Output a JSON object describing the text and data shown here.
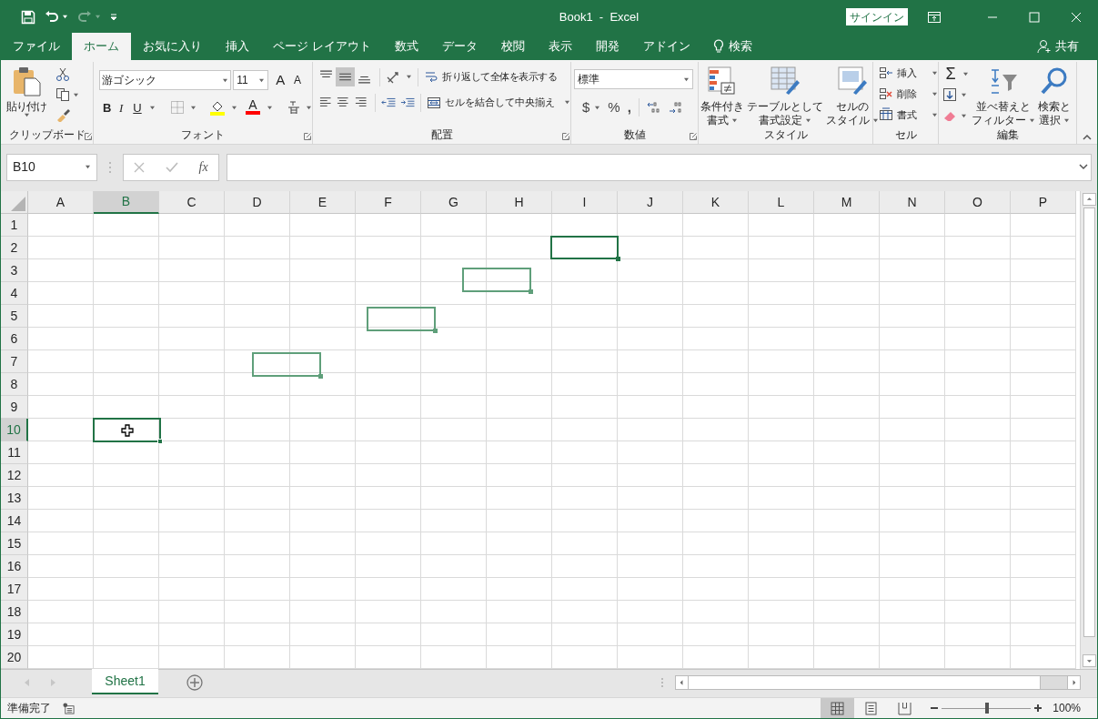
{
  "title_bar": {
    "title": "Book1  -  Excel",
    "sign_in": "サインイン"
  },
  "tabs": [
    {
      "label": "ファイル",
      "selected": false
    },
    {
      "label": "ホーム",
      "selected": true
    },
    {
      "label": "お気に入り",
      "selected": false
    },
    {
      "label": "挿入",
      "selected": false
    },
    {
      "label": "ページ レイアウト",
      "selected": false
    },
    {
      "label": "数式",
      "selected": false
    },
    {
      "label": "データ",
      "selected": false
    },
    {
      "label": "校閲",
      "selected": false
    },
    {
      "label": "表示",
      "selected": false
    },
    {
      "label": "開発",
      "selected": false
    },
    {
      "label": "アドイン",
      "selected": false
    }
  ],
  "tell_me": "検索",
  "share": "共有",
  "ribbon": {
    "clipboard": {
      "label": "クリップボード",
      "paste": "貼り付け"
    },
    "font": {
      "label": "フォント",
      "font_name": "游ゴシック",
      "font_size": "11",
      "grow": "A",
      "shrink": "A",
      "bold": "B",
      "italic": "I",
      "underline": "U",
      "font_color": "A"
    },
    "alignment": {
      "label": "配置",
      "vertical": [
        {
          "kind": "top",
          "selected": false
        },
        {
          "kind": "middle",
          "selected": true
        },
        {
          "kind": "bottom",
          "selected": false
        }
      ],
      "wrap_text": "折り返して全体を表示する",
      "merge": "セルを結合して中央揃え"
    },
    "number": {
      "label": "数値",
      "format": "標準",
      "currency": "$",
      "percent": "%",
      "comma": ","
    },
    "styles": {
      "label": "スタイル",
      "buttons": [
        {
          "kind": "conditional",
          "lines": [
            "条件付き",
            "書式"
          ]
        },
        {
          "kind": "table",
          "lines": [
            "テーブルとして",
            "書式設定"
          ]
        },
        {
          "kind": "cell_styles",
          "lines": [
            "セルの",
            "スタイル"
          ]
        }
      ]
    },
    "cells": {
      "label": "セル",
      "buttons": [
        {
          "kind": "insert",
          "label": "挿入"
        },
        {
          "kind": "delete",
          "label": "削除"
        },
        {
          "kind": "format",
          "label": "書式"
        }
      ]
    },
    "editing": {
      "label": "編集",
      "autosum": "Σ",
      "buttons": [
        {
          "kind": "sort",
          "lines": [
            "並べ替えと",
            "フィルター"
          ]
        },
        {
          "kind": "find",
          "lines": [
            "検索と",
            "選択"
          ]
        }
      ]
    }
  },
  "formula_bar": {
    "name_box": "B10",
    "insert_function": "fx"
  },
  "grid": {
    "columns": [
      {
        "label": "A",
        "selected": false
      },
      {
        "label": "B",
        "selected": true
      },
      {
        "label": "C",
        "selected": false
      },
      {
        "label": "D",
        "selected": false
      },
      {
        "label": "E",
        "selected": false
      },
      {
        "label": "F",
        "selected": false
      },
      {
        "label": "G",
        "selected": false
      },
      {
        "label": "H",
        "selected": false
      },
      {
        "label": "I",
        "selected": false
      },
      {
        "label": "J",
        "selected": false
      },
      {
        "label": "K",
        "selected": false
      },
      {
        "label": "L",
        "selected": false
      },
      {
        "label": "M",
        "selected": false
      },
      {
        "label": "N",
        "selected": false
      },
      {
        "label": "O",
        "selected": false
      },
      {
        "label": "P",
        "selected": false
      }
    ],
    "rows": [
      {
        "label": "1",
        "selected": false
      },
      {
        "label": "2",
        "selected": false
      },
      {
        "label": "3",
        "selected": false
      },
      {
        "label": "4",
        "selected": false
      },
      {
        "label": "5",
        "selected": false
      },
      {
        "label": "6",
        "selected": false
      },
      {
        "label": "7",
        "selected": false
      },
      {
        "label": "8",
        "selected": false
      },
      {
        "label": "9",
        "selected": false
      },
      {
        "label": "10",
        "selected": true
      },
      {
        "label": "11",
        "selected": false
      },
      {
        "label": "12",
        "selected": false
      },
      {
        "label": "13",
        "selected": false
      },
      {
        "label": "14",
        "selected": false
      },
      {
        "label": "15",
        "selected": false
      },
      {
        "label": "16",
        "selected": false
      },
      {
        "label": "17",
        "selected": false
      },
      {
        "label": "18",
        "selected": false
      },
      {
        "label": "19",
        "selected": false
      },
      {
        "label": "20",
        "selected": false
      }
    ]
  },
  "sheet_tabs": [
    {
      "label": "Sheet1",
      "selected": true
    }
  ],
  "status_bar": {
    "status": "準備完了",
    "views": [
      {
        "kind": "normal",
        "selected": true
      },
      {
        "kind": "page_layout",
        "selected": false
      },
      {
        "kind": "page_break",
        "selected": false
      }
    ],
    "zoom": {
      "level": 0.51
    },
    "zoom_label": "100%"
  }
}
